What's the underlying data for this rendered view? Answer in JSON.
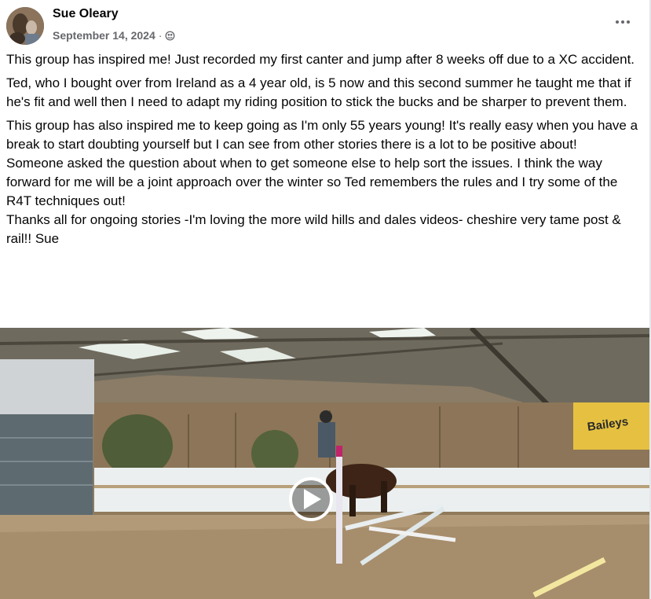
{
  "post": {
    "author": "Sue Oleary",
    "date": "September 14, 2024",
    "separator": "·",
    "privacy_icon": "globe-icon",
    "more_icon": "more-options-icon",
    "paragraphs": [
      "This group has inspired me! Just recorded my first canter and jump after 8 weeks off due to a XC accident.",
      "Ted, who I bought over from Ireland as a 4 year old, is 5 now and this second summer he taught me that if he's fit and well then I need to adapt my riding position to stick the bucks and be sharper to prevent them.",
      "This group has also inspired me to keep going as I'm only 55 years young! It's really easy when you have a break to start doubting yourself but I can see from other stories there is a lot to be positive about!",
      "Someone asked the question about when to get someone else to help sort the issues. I think the way forward for me will be a joint approach over the winter so Ted remembers the rules and I try some of the R4T techniques out!",
      "Thanks all for ongoing stories -I'm loving the more wild hills and dales videos- cheshire very tame post & rail!! Sue"
    ]
  },
  "video": {
    "play_icon": "play-icon",
    "banner_text": "Baileys"
  }
}
